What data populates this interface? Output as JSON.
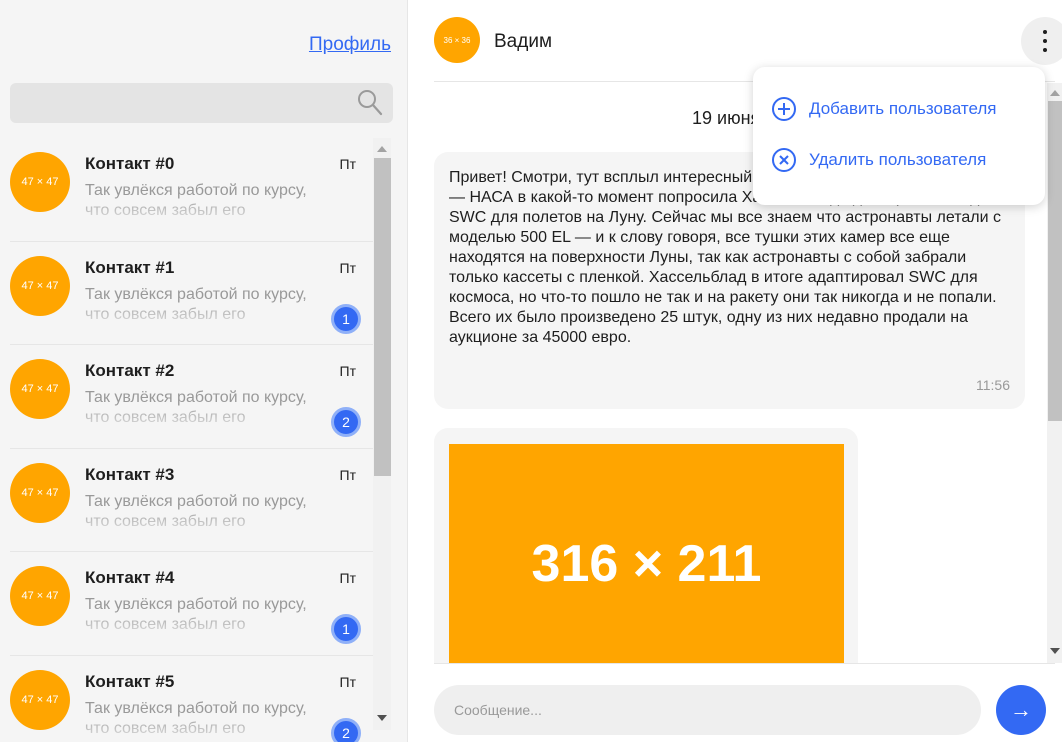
{
  "colors": {
    "accent": "#3369f3",
    "avatar_bg": "#ffa500",
    "muted_text": "#999999",
    "panel_bg": "#f5f5f5"
  },
  "sidebar": {
    "profile_link": "Профиль",
    "search": {
      "placeholder": "",
      "icon": "search-icon"
    },
    "contacts": [
      {
        "avatar": "47 × 47",
        "name": "Контакт #0",
        "day": "Пт",
        "preview": "Так увлёкся работой по курсу, что совсем забыл его",
        "unread": ""
      },
      {
        "avatar": "47 × 47",
        "name": "Контакт #1",
        "day": "Пт",
        "preview": "Так увлёкся работой по курсу, что совсем забыл его",
        "unread": "1"
      },
      {
        "avatar": "47 × 47",
        "name": "Контакт #2",
        "day": "Пт",
        "preview": "Так увлёкся работой по курсу, что совсем забыл его",
        "unread": "2"
      },
      {
        "avatar": "47 × 47",
        "name": "Контакт #3",
        "day": "Пт",
        "preview": "Так увлёкся работой по курсу, что совсем забыл его",
        "unread": ""
      },
      {
        "avatar": "47 × 47",
        "name": "Контакт #4",
        "day": "Пт",
        "preview": "Так увлёкся работой по курсу, что совсем забыл его",
        "unread": "1"
      },
      {
        "avatar": "47 × 47",
        "name": "Контакт #5",
        "day": "Пт",
        "preview": "Так увлёкся работой по курсу, что совсем забыл его",
        "unread": "2"
      }
    ]
  },
  "chat": {
    "header": {
      "avatar": "36 × 36",
      "name": "Вадим",
      "menu_icon": "more-vertical-icon"
    },
    "date": "19 июня",
    "messages": [
      {
        "text": "Привет! Смотри, тут всплыл интересный кусок лунной космической истории — НАСА в какой-то момент попросила Хассельблад адаптировать модель SWC для полетов на Луну. Сейчас мы все знаем что астронавты летали с моделью 500 EL — и к слову говоря, все тушки этих камер все еще находятся на поверхности Луны, так как астронавты с собой забрали только кассеты с пленкой. Хассельблад в итоге адаптировал SWC для космоса, но что-то пошло не так и на ракету они так никогда и не попали. Всего их было произведено 25 штук, одну из них недавно продали на аукционе за 45000 евро.",
        "time": "11:56"
      }
    ],
    "image_message": {
      "placeholder": "316 × 211"
    },
    "input": {
      "placeholder": "Сообщение...",
      "value": ""
    },
    "send": {
      "label": "→",
      "icon": "arrow-right-icon"
    }
  },
  "menu": {
    "items": [
      {
        "label": "Добавить пользователя",
        "icon": "plus-circle-icon"
      },
      {
        "label": "Удалить пользователя",
        "icon": "x-circle-icon"
      }
    ]
  }
}
